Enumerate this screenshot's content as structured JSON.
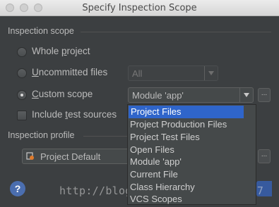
{
  "window": {
    "title": "Specify Inspection Scope"
  },
  "inspection_scope": {
    "section_label": "Inspection scope",
    "options": [
      {
        "label_pre": "Whole ",
        "label_mn": "p",
        "label_post": "roject",
        "selected": false
      },
      {
        "label_pre": "",
        "label_mn": "U",
        "label_post": "ncommitted files",
        "selected": false
      },
      {
        "label_pre": "",
        "label_mn": "C",
        "label_post": "ustom scope",
        "selected": true
      }
    ],
    "uncommitted_combo": {
      "value": "All",
      "disabled": true
    },
    "custom_scope_combo": {
      "value": "Module 'app'"
    },
    "include_tests": {
      "label_pre": "Include ",
      "label_mn": "t",
      "label_post": "est sources",
      "checked": false
    }
  },
  "inspection_profile": {
    "section_label": "Inspection profile",
    "combo_value": "Project Default"
  },
  "scope_dropdown": {
    "items": [
      "Project Files",
      "Project Production Files",
      "Project Test Files",
      "Open Files",
      "Module 'app'",
      "Current File",
      "Class Hierarchy",
      "VCS Scopes"
    ],
    "selected_index": 0
  },
  "footer": {
    "help_label": "?",
    "watermark": "http://blog.csdn.net/u011240877",
    "dots_label": "..."
  },
  "colors": {
    "background": "#3c3f41",
    "selection": "#2f65ca",
    "help": "#4b6eaf"
  }
}
